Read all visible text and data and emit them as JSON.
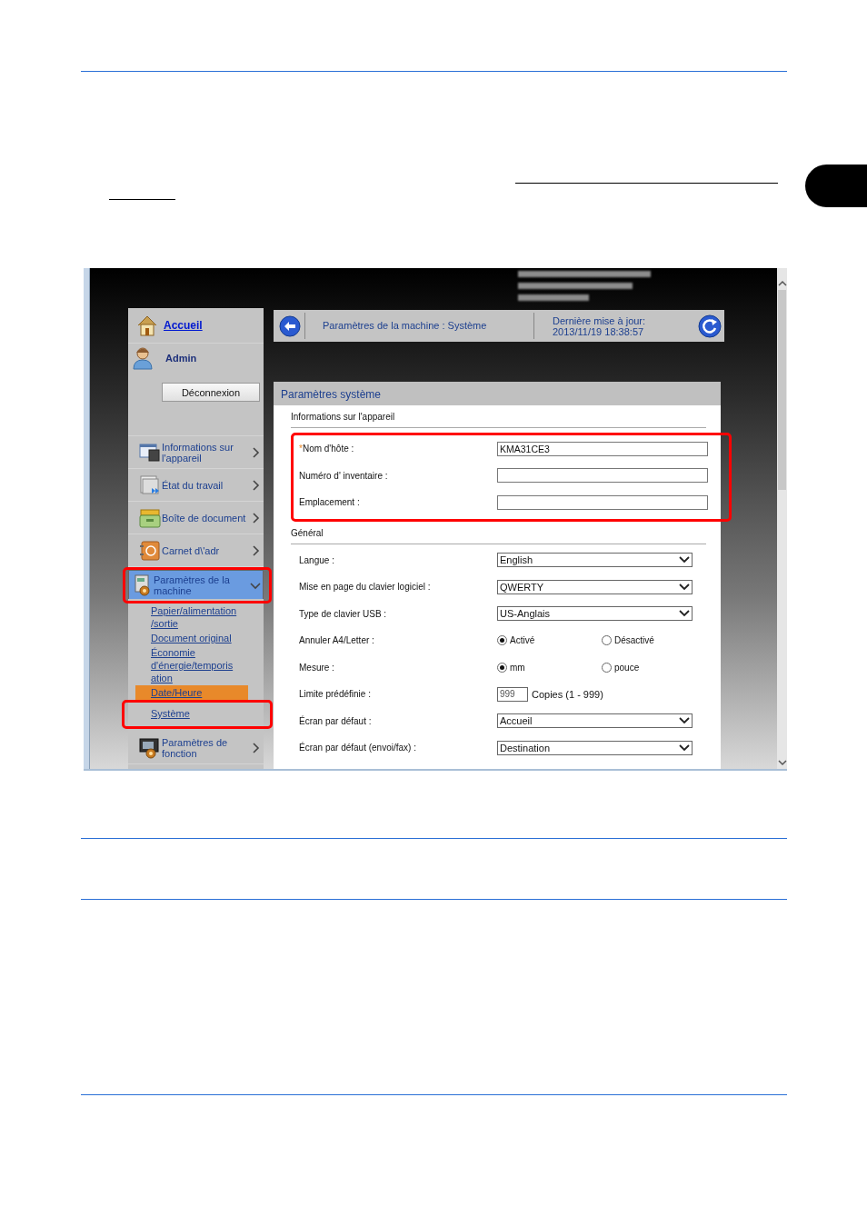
{
  "screenshot": {
    "sidebar": {
      "home_link": "Accueil",
      "user_name": "Admin",
      "logout_button": "Déconnexion",
      "items": [
        {
          "label": "Informations sur l'appareil",
          "selected": false,
          "expanded": false,
          "highlighted": false
        },
        {
          "label": "État du travail",
          "selected": false,
          "expanded": false,
          "highlighted": false
        },
        {
          "label": "Boîte de document",
          "selected": false,
          "expanded": false,
          "highlighted": false
        },
        {
          "label": "Carnet d\\'adr",
          "selected": false,
          "expanded": false,
          "highlighted": false
        },
        {
          "label": "Paramètres de la machine",
          "selected": true,
          "expanded": true,
          "highlighted": true,
          "children": [
            {
              "label": "Papier/alimentation/sortie",
              "selected": false,
              "highlighted": false
            },
            {
              "label": "Document original",
              "selected": false,
              "highlighted": false
            },
            {
              "label": "Économie d'énergie/temporisation",
              "selected": false,
              "highlighted": false
            },
            {
              "label": "Date/Heure",
              "selected": true,
              "highlighted": false
            },
            {
              "label": "Système",
              "selected": false,
              "highlighted": true
            }
          ]
        },
        {
          "label": "Paramètres de fonction",
          "selected": false,
          "expanded": false,
          "highlighted": false
        }
      ]
    },
    "top_bar": {
      "breadcrumb": "Paramètres de la machine : Système",
      "updated_label": "Dernière mise à jour:",
      "updated_time": "2013/11/19 18:38:57"
    },
    "panel": {
      "title": "Paramètres système",
      "sections": [
        {
          "title": "Informations sur l'appareil",
          "highlighted": true,
          "rows": [
            {
              "kind": "text",
              "required_mark": "*",
              "label": "Nom d'hôte :",
              "value": "KMA31CE3"
            },
            {
              "kind": "text",
              "label": "Numéro d' inventaire :"
            },
            {
              "kind": "text",
              "label": "Emplacement :"
            }
          ]
        },
        {
          "title": "Général",
          "highlighted": false,
          "rows": [
            {
              "kind": "select",
              "label": "Langue :",
              "value": "English"
            },
            {
              "kind": "select",
              "label": "Mise en page du clavier logiciel :",
              "value": "QWERTY"
            },
            {
              "kind": "select",
              "label": "Type de clavier USB :",
              "value": "US-Anglais"
            },
            {
              "kind": "radio",
              "label": "Annuler A4/Letter  :",
              "options": [
                {
                  "label": "Activé",
                  "selected": true
                },
                {
                  "label": "Désactivé",
                  "selected": false
                }
              ]
            },
            {
              "kind": "radio",
              "label": "Mesure  :",
              "options": [
                {
                  "label": "mm",
                  "selected": true
                },
                {
                  "label": "pouce",
                  "selected": false
                }
              ]
            },
            {
              "kind": "number",
              "label": "Limite prédéfinie  :",
              "value": "999",
              "suffix": "Copies (1 - 999)"
            },
            {
              "kind": "select",
              "label": "Écran par défaut  :",
              "value": "Accueil"
            },
            {
              "kind": "select",
              "label": "Écran par défaut (envoi/fax) :",
              "value": "Destination"
            }
          ]
        }
      ]
    }
  }
}
